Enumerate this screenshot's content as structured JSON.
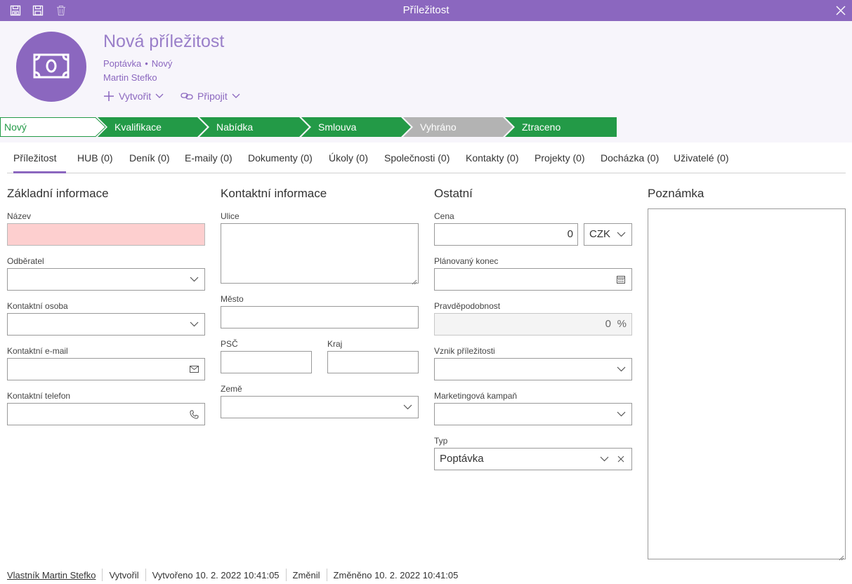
{
  "window": {
    "title": "Příležitost"
  },
  "header": {
    "title": "Nová příležitost",
    "type": "Poptávka",
    "status": "Nový",
    "owner": "Martin Stefko",
    "actions": {
      "create": "Vytvořit",
      "connect": "Připojit"
    }
  },
  "stages": [
    {
      "label": "Nový",
      "state": "current"
    },
    {
      "label": "Kvalifikace",
      "state": "active"
    },
    {
      "label": "Nabídka",
      "state": "active"
    },
    {
      "label": "Smlouva",
      "state": "active"
    },
    {
      "label": "Vyhráno",
      "state": "disabled"
    },
    {
      "label": "Ztraceno",
      "state": "active"
    }
  ],
  "tabs": [
    {
      "label": "Příležitost"
    },
    {
      "label": "HUB (0)"
    },
    {
      "label": "Deník (0)"
    },
    {
      "label": "E-maily (0)"
    },
    {
      "label": "Dokumenty (0)"
    },
    {
      "label": "Úkoly (0)"
    },
    {
      "label": "Společnosti (0)"
    },
    {
      "label": "Kontakty (0)"
    },
    {
      "label": "Projekty (0)"
    },
    {
      "label": "Docházka (0)"
    },
    {
      "label": "Uživatelé (0)"
    }
  ],
  "basic": {
    "title": "Základní informace",
    "name_label": "Název",
    "customer_label": "Odběratel",
    "contact_person_label": "Kontaktní osoba",
    "contact_email_label": "Kontaktní e-mail",
    "contact_phone_label": "Kontaktní telefon"
  },
  "contact": {
    "title": "Kontaktní informace",
    "street_label": "Ulice",
    "city_label": "Město",
    "zip_label": "PSČ",
    "region_label": "Kraj",
    "country_label": "Země"
  },
  "other": {
    "title": "Ostatní",
    "price_label": "Cena",
    "price_value": "0",
    "currency": "CZK",
    "planned_end_label": "Plánovaný konec",
    "probability_label": "Pravděpodobnost",
    "probability_value": "0",
    "probability_unit": "%",
    "origin_label": "Vznik příležitosti",
    "campaign_label": "Marketingová kampaň",
    "type_label": "Typ",
    "type_value": "Poptávka"
  },
  "note": {
    "title": "Poznámka"
  },
  "footer": {
    "owner": "Vlastník Martin Stefko",
    "created_by": "Vytvořil",
    "created": "Vytvořeno 10. 2. 2022 10:41:05",
    "changed_by": "Změnil",
    "changed": "Změněno 10. 2. 2022 10:41:05"
  },
  "colors": {
    "accent": "#8b67bf",
    "stage_green": "#239a47",
    "stage_disabled": "#b3b3b3",
    "required_bg": "#fdcfcf"
  }
}
